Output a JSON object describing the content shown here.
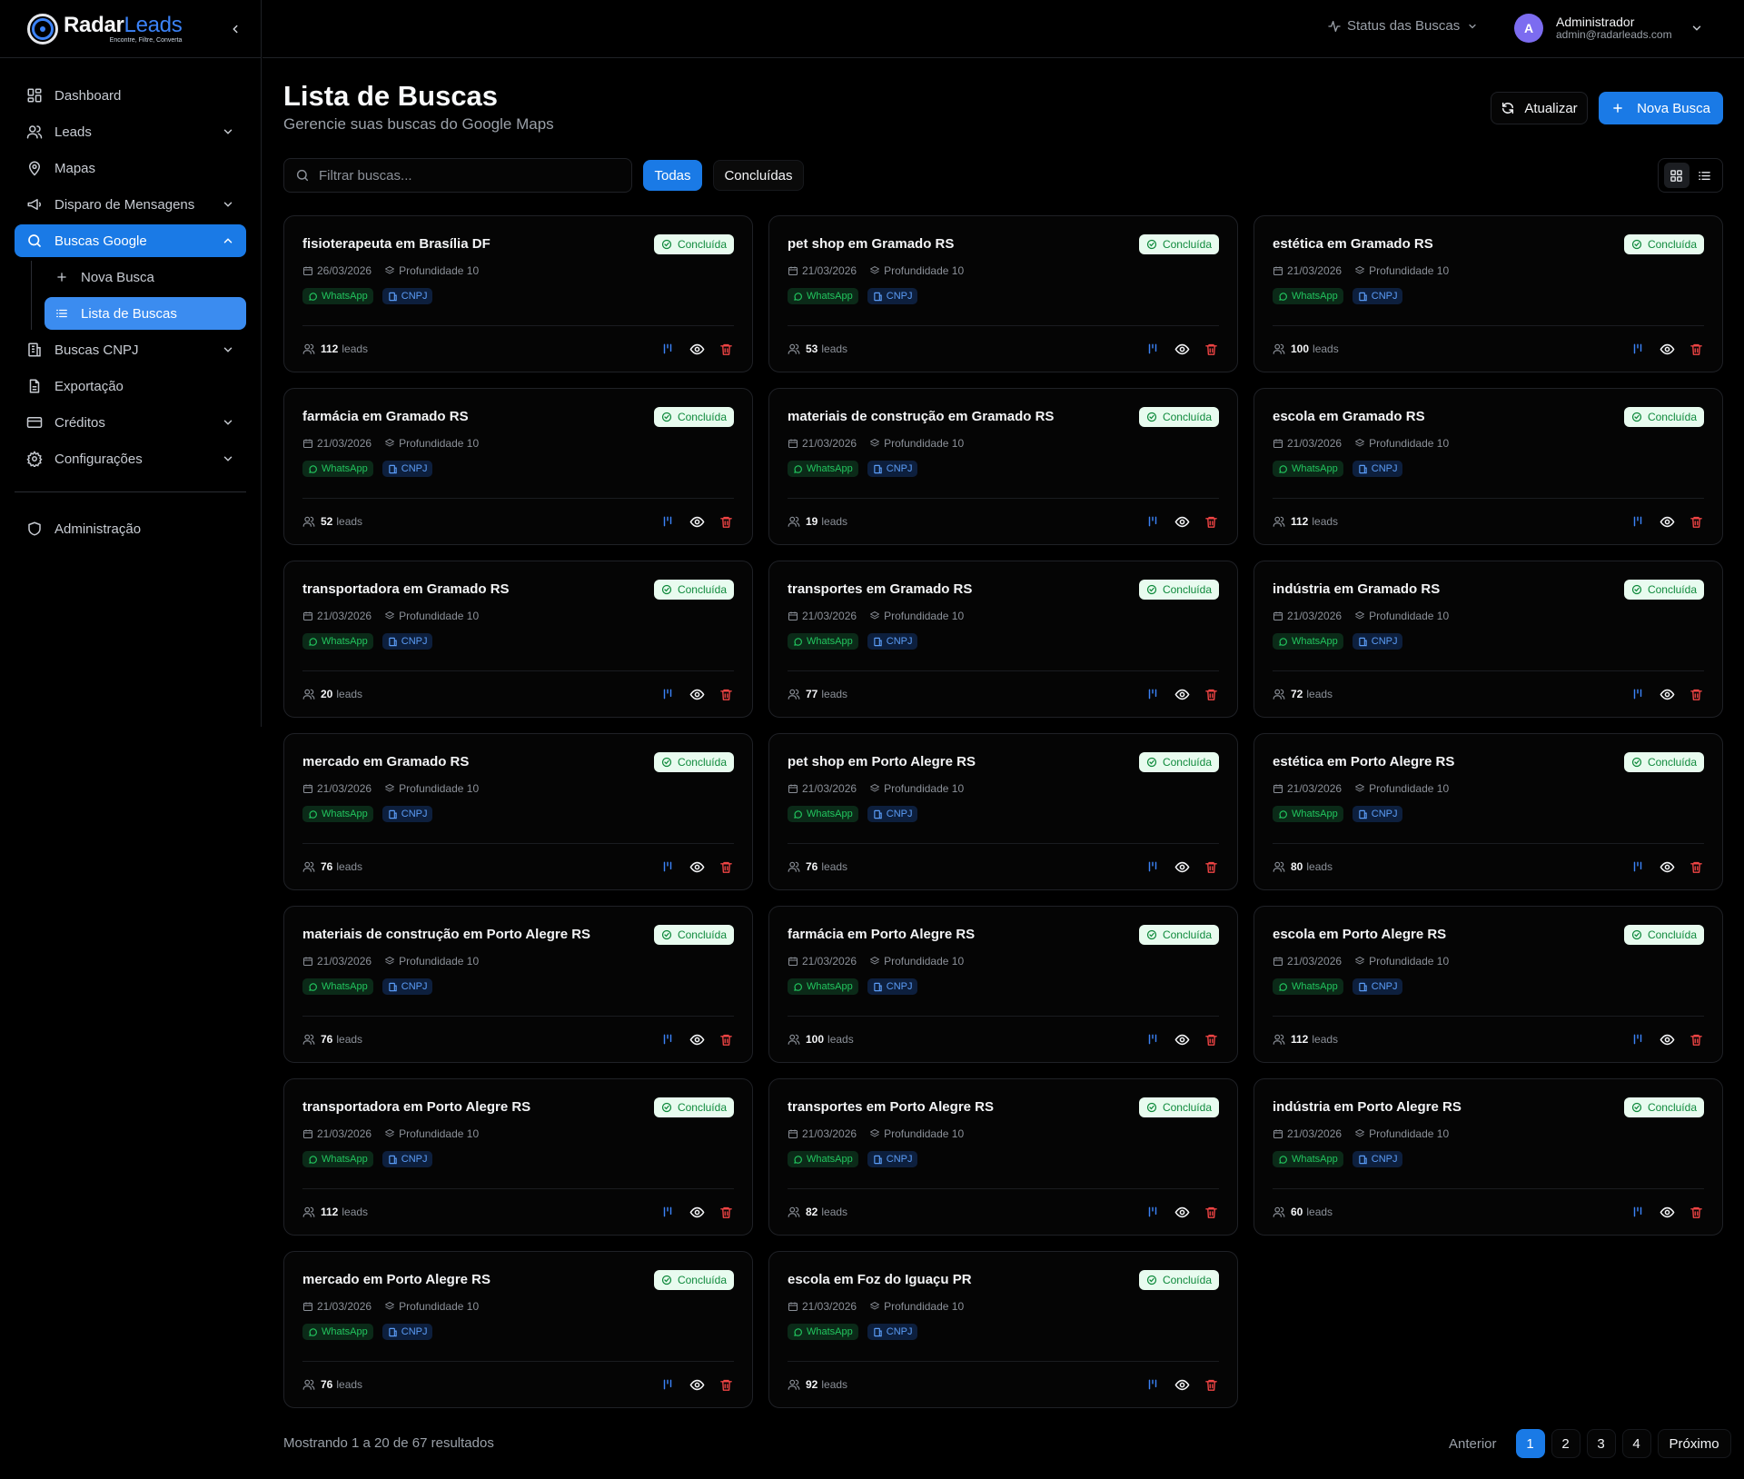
{
  "brand": {
    "name_white": "Radar",
    "name_blue": "Leads",
    "tagline": "Encontre, Filtre, Converta"
  },
  "sidebar": {
    "items": [
      {
        "label": "Dashboard",
        "icon": "dashboard-icon"
      },
      {
        "label": "Leads",
        "icon": "users-icon"
      },
      {
        "label": "Mapas",
        "icon": "map-pin-icon"
      },
      {
        "label": "Disparo de Mensagens",
        "icon": "megaphone-icon"
      },
      {
        "label": "Buscas Google",
        "icon": "search-icon"
      },
      {
        "label": "Buscas CNPJ",
        "icon": "building-icon"
      },
      {
        "label": "Exportação",
        "icon": "file-icon"
      },
      {
        "label": "Créditos",
        "icon": "credit-card-icon"
      },
      {
        "label": "Configurações",
        "icon": "gear-icon"
      }
    ],
    "sub_items": [
      {
        "label": "Nova Busca",
        "icon": "plus-icon"
      },
      {
        "label": "Lista de Buscas",
        "icon": "list-icon"
      }
    ],
    "admin": {
      "label": "Administração",
      "icon": "shield-icon"
    }
  },
  "topbar": {
    "status_label": "Status das Buscas",
    "user_initial": "A",
    "user_name": "Administrador",
    "user_email": "admin@radarleads.com"
  },
  "header": {
    "title": "Lista de Buscas",
    "subtitle": "Gerencie suas buscas do Google Maps",
    "refresh_label": "Atualizar",
    "new_label": "Nova Busca"
  },
  "filters": {
    "search_placeholder": "Filtrar buscas...",
    "all_label": "Todas",
    "done_label": "Concluídas"
  },
  "card_labels": {
    "status": "Concluída",
    "depth": "Profundidade 10",
    "whatsapp": "WhatsApp",
    "cnpj": "CNPJ",
    "leads_suffix": "leads"
  },
  "cards": [
    {
      "title": "fisioterapeuta em Brasília DF",
      "date": "26/03/2026",
      "leads": "112"
    },
    {
      "title": "pet shop em Gramado RS",
      "date": "21/03/2026",
      "leads": "53"
    },
    {
      "title": "estética em Gramado RS",
      "date": "21/03/2026",
      "leads": "100"
    },
    {
      "title": "farmácia em Gramado RS",
      "date": "21/03/2026",
      "leads": "52"
    },
    {
      "title": "materiais de construção em Gramado RS",
      "date": "21/03/2026",
      "leads": "19"
    },
    {
      "title": "escola em Gramado RS",
      "date": "21/03/2026",
      "leads": "112"
    },
    {
      "title": "transportadora em Gramado RS",
      "date": "21/03/2026",
      "leads": "20"
    },
    {
      "title": "transportes em Gramado RS",
      "date": "21/03/2026",
      "leads": "77"
    },
    {
      "title": "indústria em Gramado RS",
      "date": "21/03/2026",
      "leads": "72"
    },
    {
      "title": "mercado em Gramado RS",
      "date": "21/03/2026",
      "leads": "76"
    },
    {
      "title": "pet shop em Porto Alegre RS",
      "date": "21/03/2026",
      "leads": "76"
    },
    {
      "title": "estética em Porto Alegre RS",
      "date": "21/03/2026",
      "leads": "80"
    },
    {
      "title": "materiais de construção em Porto Alegre RS",
      "date": "21/03/2026",
      "leads": "76"
    },
    {
      "title": "farmácia em Porto Alegre RS",
      "date": "21/03/2026",
      "leads": "100"
    },
    {
      "title": "escola em Porto Alegre RS",
      "date": "21/03/2026",
      "leads": "112"
    },
    {
      "title": "transportadora em Porto Alegre RS",
      "date": "21/03/2026",
      "leads": "112"
    },
    {
      "title": "transportes em Porto Alegre RS",
      "date": "21/03/2026",
      "leads": "82"
    },
    {
      "title": "indústria em Porto Alegre RS",
      "date": "21/03/2026",
      "leads": "60"
    },
    {
      "title": "mercado em Porto Alegre RS",
      "date": "21/03/2026",
      "leads": "76"
    },
    {
      "title": "escola em Foz do Iguaçu PR",
      "date": "21/03/2026",
      "leads": "92"
    }
  ],
  "pagination": {
    "summary": "Mostrando 1 a 20 de 67 resultados",
    "prev": "Anterior",
    "pages": [
      "1",
      "2",
      "3",
      "4"
    ],
    "current": "1",
    "next": "Próximo"
  },
  "colors": {
    "accent": "#1a7ae6",
    "success": "#22c55e",
    "danger": "#ef4444",
    "info": "#3b82f6"
  }
}
